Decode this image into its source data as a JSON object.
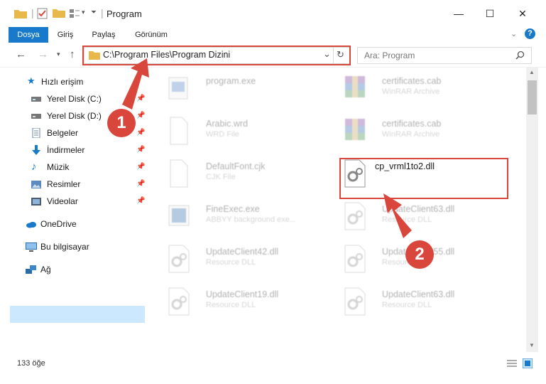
{
  "window": {
    "title": "Program",
    "minimize": "—",
    "maximize": "☐",
    "close": "✕"
  },
  "ribbon": {
    "tabs": [
      "Dosya",
      "Giriş",
      "Paylaş",
      "Görünüm"
    ]
  },
  "address": {
    "path": "C:\\Program Files\\Program Dizini",
    "search_placeholder": "Ara: Program"
  },
  "sidebar": {
    "quick_access": "Hızlı erişim",
    "items": [
      {
        "label": "Yerel Disk (C:)",
        "icon": "drive-icon"
      },
      {
        "label": "Yerel Disk (D:)",
        "icon": "drive-icon"
      },
      {
        "label": "Belgeler",
        "icon": "documents-icon"
      },
      {
        "label": "İndirmeler",
        "icon": "download-icon"
      },
      {
        "label": "Müzik",
        "icon": "music-icon"
      },
      {
        "label": "Resimler",
        "icon": "pictures-icon"
      },
      {
        "label": "Videolar",
        "icon": "videos-icon"
      }
    ],
    "onedrive": "OneDrive",
    "this_pc": "Bu bilgisayar",
    "network": "Ağ"
  },
  "files": [
    {
      "name": "program.exe",
      "type": ""
    },
    {
      "name": "certificates.cab",
      "type": "WinRAR Archive"
    },
    {
      "name": "Arabic.wrd",
      "type": "WRD File"
    },
    {
      "name": "certificates.cab",
      "type": "WinRAR Archive"
    },
    {
      "name": "DefaultFont.cjk",
      "type": "CJK File"
    },
    {
      "name": "cp_vrml1to2.dll",
      "type": ""
    },
    {
      "name": "FineExec.exe",
      "type": "ABBYY background exe..."
    },
    {
      "name": "UpdateClient63.dll",
      "type": "Resource DLL"
    },
    {
      "name": "UpdateClient42.dll",
      "type": "Resource DLL"
    },
    {
      "name": "UpdateClient55.dll",
      "type": "Resource DLL"
    },
    {
      "name": "UpdateClient19.dll",
      "type": "Resource DLL"
    },
    {
      "name": "UpdateClient63.dll",
      "type": "Resource DLL"
    }
  ],
  "status": {
    "count": "133 öğe"
  },
  "annotations": {
    "step1": "1",
    "step2": "2"
  },
  "colors": {
    "accent": "#1979ca",
    "highlight": "#d9463c",
    "selection": "#cce8ff"
  }
}
